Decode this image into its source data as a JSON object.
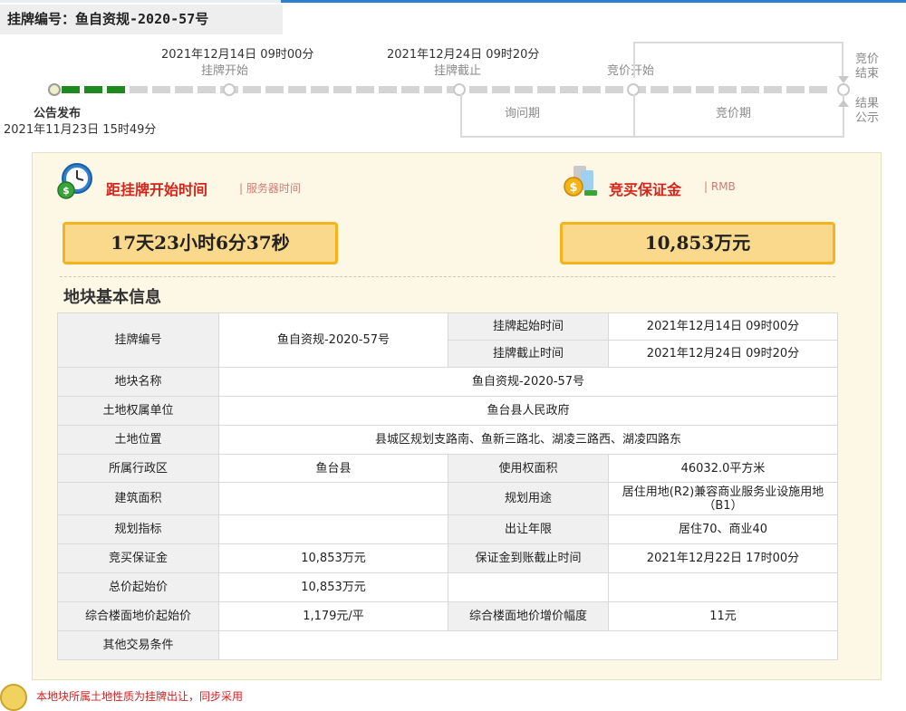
{
  "header": {
    "title": "挂牌编号：鱼自资规-2020-57号"
  },
  "timeline": {
    "start": {
      "label": "公告发布",
      "date": "2021年11月23日 15时49分"
    },
    "listing_start": {
      "date": "2021年12月14日 09时00分",
      "label": "挂牌开始"
    },
    "listing_end": {
      "date": "2021年12月24日 09时20分",
      "label": "挂牌截止"
    },
    "bid_start": {
      "label": "竞价开始"
    },
    "bid_end": {
      "label": "竞价结束"
    },
    "result": {
      "label": "结果公示"
    },
    "phase_inquiry": "询问期",
    "phase_bidding": "竞价期",
    "progress_fraction": 0.1
  },
  "countdown": {
    "title": "距挂牌开始时间",
    "subtitle": "服务器时间",
    "value": "17天23小时6分37秒"
  },
  "deposit": {
    "title": "竞买保证金",
    "subtitle": "RMB",
    "value": "10,853万元"
  },
  "section_title": "地块基本信息",
  "table": {
    "listing_no_label": "挂牌编号",
    "listing_no": "鱼自资规-2020-57号",
    "listing_start_label": "挂牌起始时间",
    "listing_start": "2021年12月14日 09时00分",
    "listing_end_label": "挂牌截止时间",
    "listing_end": "2021年12月24日 09时20分",
    "parcel_name_label": "地块名称",
    "parcel_name": "鱼自资规-2020-57号",
    "owner_label": "土地权属单位",
    "owner": "鱼台县人民政府",
    "location_label": "土地位置",
    "location": "县城区规划支路南、鱼新三路北、湖凌三路西、湖凌四路东",
    "district_label": "所属行政区",
    "district": "鱼台县",
    "area_label": "使用权面积",
    "area": "46032.0平方米",
    "building_area_label": "建筑面积",
    "building_area": "",
    "usage_label": "规划用途",
    "usage": "居住用地(R2)兼容商业服务业设施用地（B1）",
    "plan_index_label": "规划指标",
    "plan_index": "",
    "term_label": "出让年限",
    "term": "居住70、商业40",
    "deposit_label": "竞买保证金",
    "deposit": "10,853万元",
    "deposit_deadline_label": "保证金到账截止时间",
    "deposit_deadline": "2021年12月22日 17时00分",
    "start_price_label": "总价起始价",
    "start_price": "10,853万元",
    "floor_price_label": "综合楼面地价起始价",
    "floor_price": "1,179元/平",
    "increment_label": "综合楼面地价增价幅度",
    "increment": "11元",
    "other_label": "其他交易条件",
    "other": ""
  },
  "footer_note": "本地块所属土地性质为挂牌出让，同步采用"
}
